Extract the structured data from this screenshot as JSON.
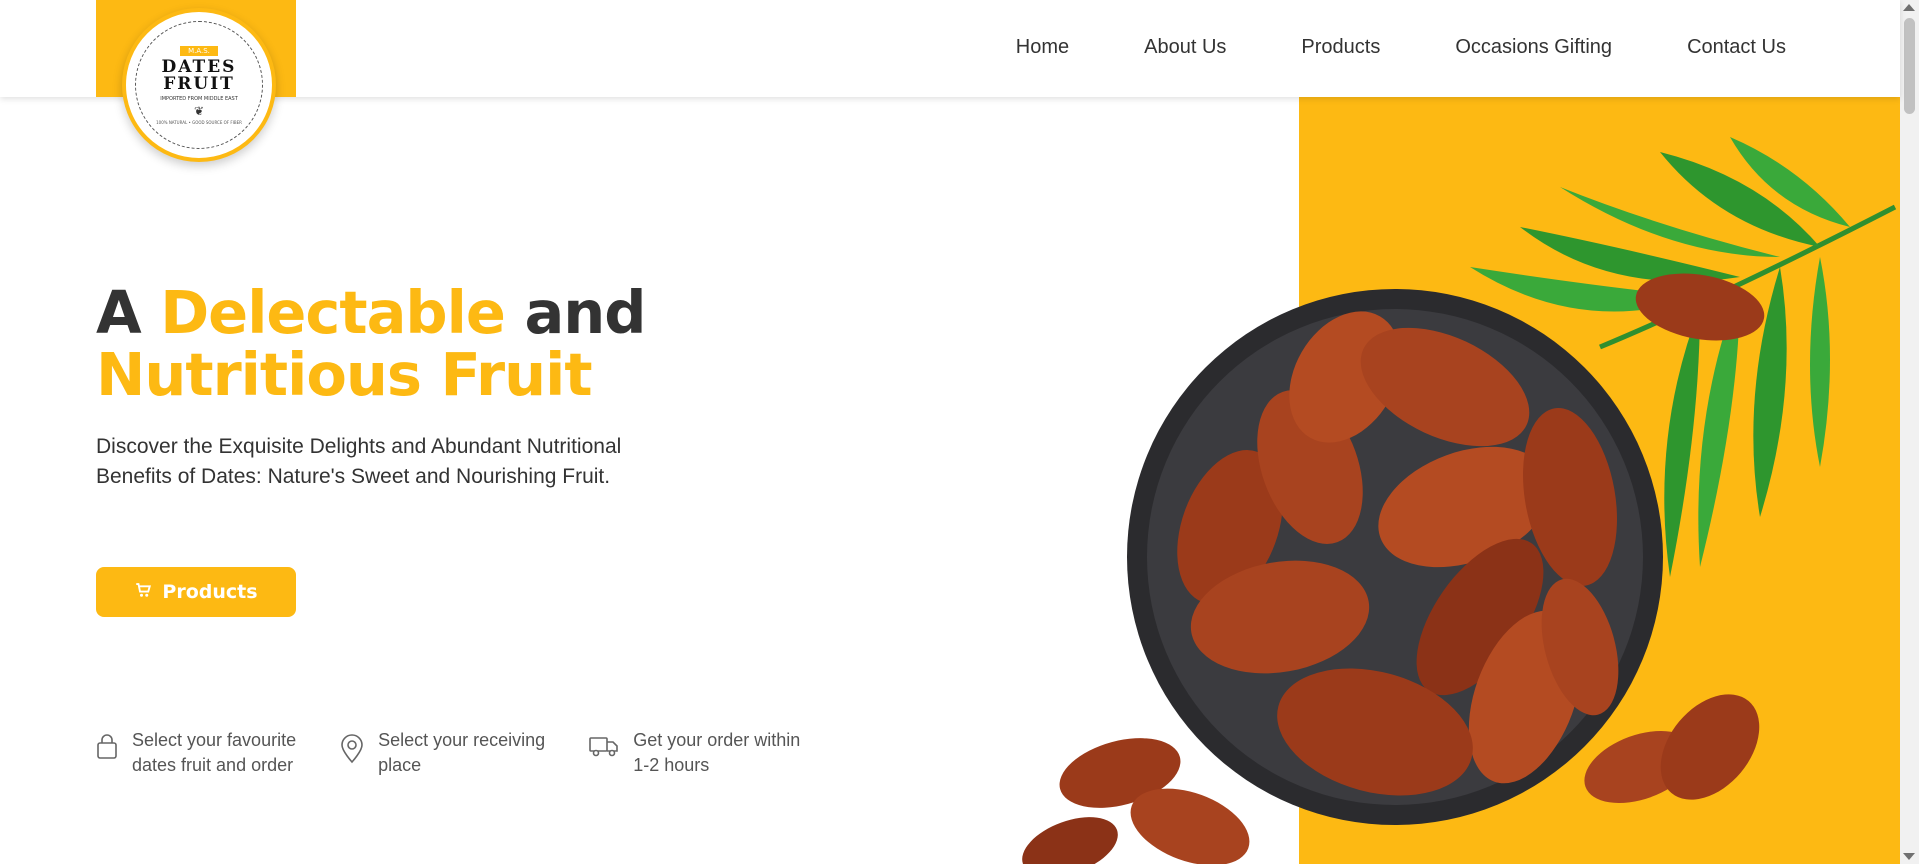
{
  "brand": {
    "tag": "M.A.S.",
    "line1": "DATES",
    "line2": "FRUIT",
    "subtitle": "IMPORTED FROM MIDDLE EAST",
    "footer": "100% NATURAL • GOOD SOURCE OF FIBER"
  },
  "nav": {
    "items": [
      {
        "label": "Home"
      },
      {
        "label": "About Us"
      },
      {
        "label": "Products"
      },
      {
        "label": "Occasions Gifting"
      },
      {
        "label": "Contact Us"
      }
    ]
  },
  "hero": {
    "title_part1": "A ",
    "title_accent1": "Delectable",
    "title_part2": " and",
    "title_accent2": "Nutritious Fruit",
    "subtitle": "Discover the Exquisite Delights and Abundant Nutritional Benefits of Dates: Nature's Sweet and Nourishing Fruit.",
    "cta_label": "Products"
  },
  "features": [
    {
      "icon": "shopping-bag-icon",
      "text_line1": "Select your favourite",
      "text_line2": "dates fruit and order"
    },
    {
      "icon": "location-pin-icon",
      "text_line1": "Select your receiving",
      "text_line2": "place"
    },
    {
      "icon": "delivery-truck-icon",
      "text_line1": "Get your order within",
      "text_line2": "1-2 hours"
    }
  ],
  "colors": {
    "accent": "#FDB913",
    "text": "#333333",
    "muted": "#555555"
  }
}
